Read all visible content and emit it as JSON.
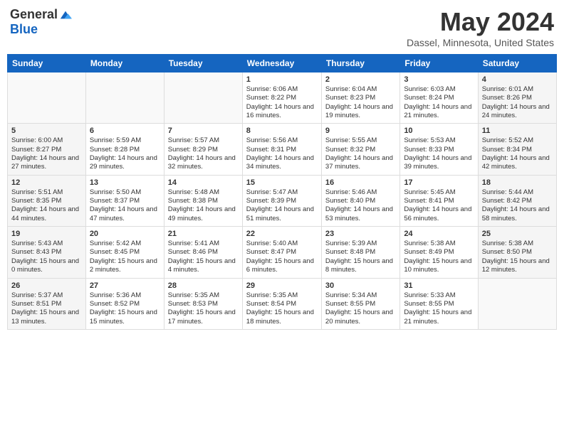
{
  "header": {
    "logo_general": "General",
    "logo_blue": "Blue",
    "month_title": "May 2024",
    "location": "Dassel, Minnesota, United States"
  },
  "calendar": {
    "days_of_week": [
      "Sunday",
      "Monday",
      "Tuesday",
      "Wednesday",
      "Thursday",
      "Friday",
      "Saturday"
    ],
    "weeks": [
      [
        {
          "day": "",
          "content": ""
        },
        {
          "day": "",
          "content": ""
        },
        {
          "day": "",
          "content": ""
        },
        {
          "day": "1",
          "content": "Sunrise: 6:06 AM\nSunset: 8:22 PM\nDaylight: 14 hours and 16 minutes."
        },
        {
          "day": "2",
          "content": "Sunrise: 6:04 AM\nSunset: 8:23 PM\nDaylight: 14 hours and 19 minutes."
        },
        {
          "day": "3",
          "content": "Sunrise: 6:03 AM\nSunset: 8:24 PM\nDaylight: 14 hours and 21 minutes."
        },
        {
          "day": "4",
          "content": "Sunrise: 6:01 AM\nSunset: 8:26 PM\nDaylight: 14 hours and 24 minutes."
        }
      ],
      [
        {
          "day": "5",
          "content": "Sunrise: 6:00 AM\nSunset: 8:27 PM\nDaylight: 14 hours and 27 minutes."
        },
        {
          "day": "6",
          "content": "Sunrise: 5:59 AM\nSunset: 8:28 PM\nDaylight: 14 hours and 29 minutes."
        },
        {
          "day": "7",
          "content": "Sunrise: 5:57 AM\nSunset: 8:29 PM\nDaylight: 14 hours and 32 minutes."
        },
        {
          "day": "8",
          "content": "Sunrise: 5:56 AM\nSunset: 8:31 PM\nDaylight: 14 hours and 34 minutes."
        },
        {
          "day": "9",
          "content": "Sunrise: 5:55 AM\nSunset: 8:32 PM\nDaylight: 14 hours and 37 minutes."
        },
        {
          "day": "10",
          "content": "Sunrise: 5:53 AM\nSunset: 8:33 PM\nDaylight: 14 hours and 39 minutes."
        },
        {
          "day": "11",
          "content": "Sunrise: 5:52 AM\nSunset: 8:34 PM\nDaylight: 14 hours and 42 minutes."
        }
      ],
      [
        {
          "day": "12",
          "content": "Sunrise: 5:51 AM\nSunset: 8:35 PM\nDaylight: 14 hours and 44 minutes."
        },
        {
          "day": "13",
          "content": "Sunrise: 5:50 AM\nSunset: 8:37 PM\nDaylight: 14 hours and 47 minutes."
        },
        {
          "day": "14",
          "content": "Sunrise: 5:48 AM\nSunset: 8:38 PM\nDaylight: 14 hours and 49 minutes."
        },
        {
          "day": "15",
          "content": "Sunrise: 5:47 AM\nSunset: 8:39 PM\nDaylight: 14 hours and 51 minutes."
        },
        {
          "day": "16",
          "content": "Sunrise: 5:46 AM\nSunset: 8:40 PM\nDaylight: 14 hours and 53 minutes."
        },
        {
          "day": "17",
          "content": "Sunrise: 5:45 AM\nSunset: 8:41 PM\nDaylight: 14 hours and 56 minutes."
        },
        {
          "day": "18",
          "content": "Sunrise: 5:44 AM\nSunset: 8:42 PM\nDaylight: 14 hours and 58 minutes."
        }
      ],
      [
        {
          "day": "19",
          "content": "Sunrise: 5:43 AM\nSunset: 8:43 PM\nDaylight: 15 hours and 0 minutes."
        },
        {
          "day": "20",
          "content": "Sunrise: 5:42 AM\nSunset: 8:45 PM\nDaylight: 15 hours and 2 minutes."
        },
        {
          "day": "21",
          "content": "Sunrise: 5:41 AM\nSunset: 8:46 PM\nDaylight: 15 hours and 4 minutes."
        },
        {
          "day": "22",
          "content": "Sunrise: 5:40 AM\nSunset: 8:47 PM\nDaylight: 15 hours and 6 minutes."
        },
        {
          "day": "23",
          "content": "Sunrise: 5:39 AM\nSunset: 8:48 PM\nDaylight: 15 hours and 8 minutes."
        },
        {
          "day": "24",
          "content": "Sunrise: 5:38 AM\nSunset: 8:49 PM\nDaylight: 15 hours and 10 minutes."
        },
        {
          "day": "25",
          "content": "Sunrise: 5:38 AM\nSunset: 8:50 PM\nDaylight: 15 hours and 12 minutes."
        }
      ],
      [
        {
          "day": "26",
          "content": "Sunrise: 5:37 AM\nSunset: 8:51 PM\nDaylight: 15 hours and 13 minutes."
        },
        {
          "day": "27",
          "content": "Sunrise: 5:36 AM\nSunset: 8:52 PM\nDaylight: 15 hours and 15 minutes."
        },
        {
          "day": "28",
          "content": "Sunrise: 5:35 AM\nSunset: 8:53 PM\nDaylight: 15 hours and 17 minutes."
        },
        {
          "day": "29",
          "content": "Sunrise: 5:35 AM\nSunset: 8:54 PM\nDaylight: 15 hours and 18 minutes."
        },
        {
          "day": "30",
          "content": "Sunrise: 5:34 AM\nSunset: 8:55 PM\nDaylight: 15 hours and 20 minutes."
        },
        {
          "day": "31",
          "content": "Sunrise: 5:33 AM\nSunset: 8:55 PM\nDaylight: 15 hours and 21 minutes."
        },
        {
          "day": "",
          "content": ""
        }
      ]
    ]
  }
}
